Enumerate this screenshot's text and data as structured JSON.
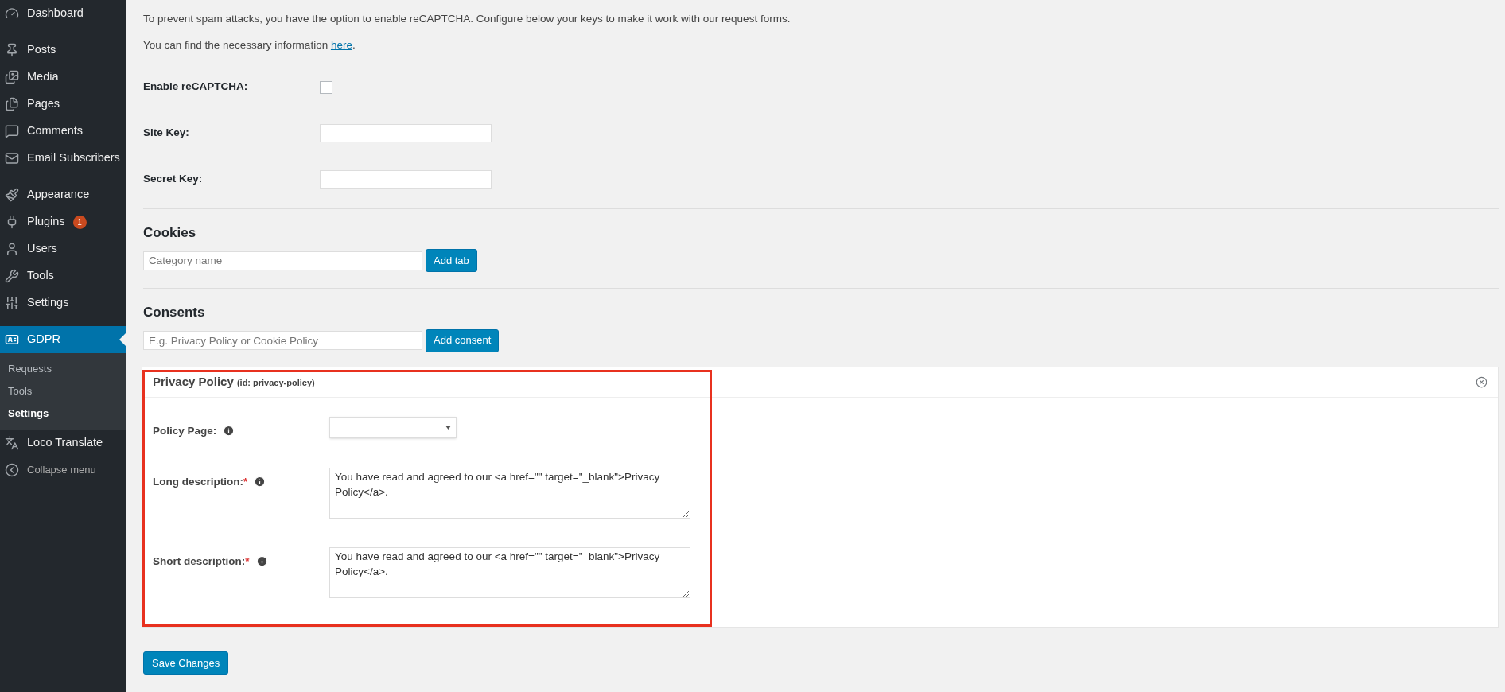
{
  "sidebar": {
    "items": [
      {
        "label": "Dashboard",
        "selected": false
      },
      {
        "label": "Posts",
        "selected": false
      },
      {
        "label": "Media",
        "selected": false
      },
      {
        "label": "Pages",
        "selected": false
      },
      {
        "label": "Comments",
        "selected": false
      },
      {
        "label": "Email Subscribers",
        "selected": false
      },
      {
        "label": "Appearance",
        "selected": false
      },
      {
        "label": "Plugins",
        "selected": false,
        "badge": "1"
      },
      {
        "label": "Users",
        "selected": false
      },
      {
        "label": "Tools",
        "selected": false
      },
      {
        "label": "Settings",
        "selected": false
      },
      {
        "label": "GDPR",
        "selected": true,
        "children": [
          {
            "label": "Requests",
            "selected": false
          },
          {
            "label": "Tools",
            "selected": false
          },
          {
            "label": "Settings",
            "selected": true
          }
        ]
      },
      {
        "label": "Loco Translate",
        "selected": false
      }
    ],
    "collapse": "Collapse menu"
  },
  "intro": [
    "To prevent spam attacks, you have the option to enable reCAPTCHA. Configure below your keys to make it work with our request forms."
  ],
  "info": {
    "text": "You can find the necessary information",
    "link": "here",
    "after": "."
  },
  "recaptcha": {
    "enable_label": "Enable reCAPTCHA:",
    "checked": false,
    "fields": [
      {
        "label": "Site Key:"
      },
      {
        "label": "Secret Key:"
      }
    ]
  },
  "cookies": {
    "title": "Cookies",
    "placeholder": "Category name",
    "button": "Add tab"
  },
  "consents": {
    "title": "Consents",
    "placeholder": "E.g. Privacy Policy or Cookie Policy",
    "button": "Add consent"
  },
  "policy": {
    "title": "Privacy Policy",
    "id_text": "(id: privacy-policy)",
    "highlighted": true,
    "rows": [
      {
        "kind": "select",
        "label": "Policy Page:"
      },
      {
        "kind": "textarea",
        "label": "Long description:",
        "required_mark": "*",
        "value": "You have read and agreed to our <a href=\"\" target=\"_blank\">Privacy Policy</a>."
      },
      {
        "kind": "textarea",
        "label": "Short description:",
        "required_mark": "*",
        "value": "You have read and agreed to our <a href=\"\" target=\"_blank\">Privacy Policy</a>."
      }
    ]
  },
  "save_button": "Save Changes"
}
